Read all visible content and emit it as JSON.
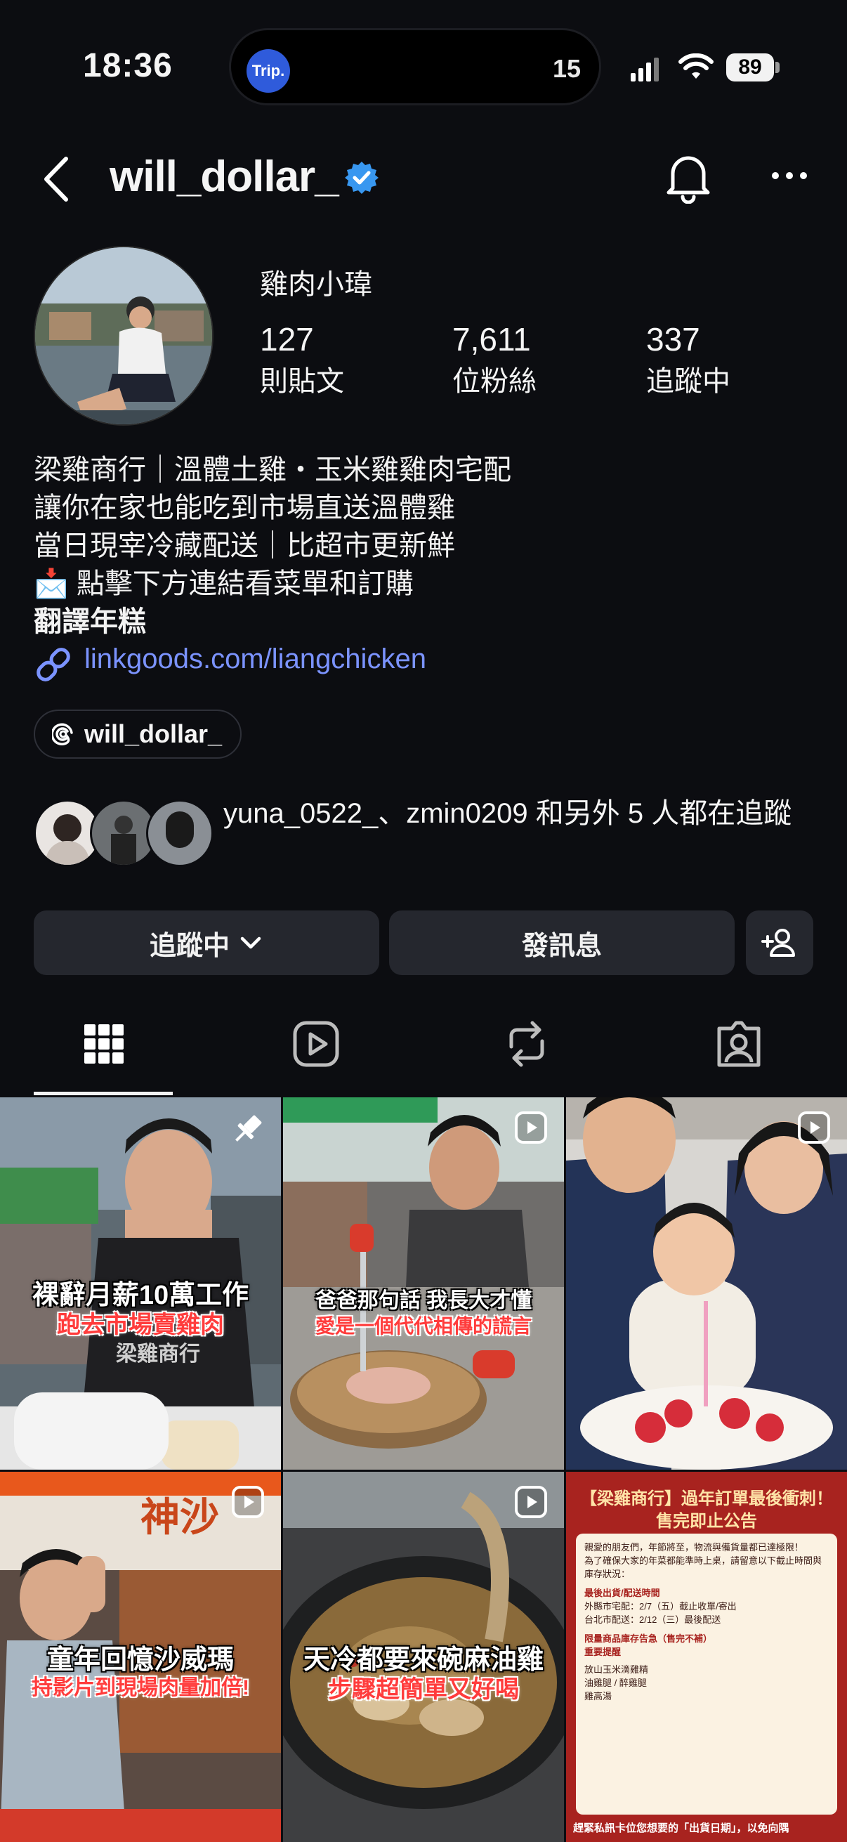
{
  "status_bar": {
    "time": "18:36",
    "island_app": "Trip.",
    "island_count": "15",
    "battery": "89"
  },
  "header": {
    "username": "will_dollar_",
    "verified": true,
    "icons": [
      "back-arrow-icon",
      "verified-badge-icon",
      "bell-icon",
      "more-icon"
    ]
  },
  "profile": {
    "display_name": "雞肉小瑋",
    "stats": [
      {
        "value": "127",
        "label": "則貼文"
      },
      {
        "value": "7,611",
        "label": "位粉絲"
      },
      {
        "value": "337",
        "label": "追蹤中"
      }
    ],
    "bio": [
      "梁雞商行｜溫體土雞・玉米雞雞肉宅配",
      "讓你在家也能吃到市場直送溫體雞",
      "當日現宰冷藏配送｜比超市更新鮮",
      "📩 點擊下方連結看菜單和訂購"
    ],
    "translate": "翻譯年糕",
    "link": "linkgoods.com/liangchicken",
    "threads_handle": "will_dollar_",
    "followed_by": "yuna_0522_、zmin0209 和另外 5 人都在追蹤"
  },
  "actions": {
    "following": "追蹤中",
    "message": "發訊息"
  },
  "tabs": [
    "grid-icon",
    "reels-icon",
    "reposts-icon",
    "tagged-icon"
  ],
  "posts": [
    {
      "caption1": "裸辭月薪10萬工作",
      "caption2": "跑去市場賣雞肉",
      "pinned": true,
      "apron_text": "梁雞商行"
    },
    {
      "caption1": "爸爸那句話 我長大才懂",
      "caption2": "愛是一個代代相傳的謊言",
      "reel": true
    },
    {
      "caption1": "",
      "caption2": "",
      "reel": true
    },
    {
      "caption1": "童年回憶沙威瑪",
      "caption2": "持影片到現場肉量加倍!",
      "reel": true,
      "sign_text": "神沙"
    },
    {
      "caption1": "天冷都要來碗麻油雞",
      "caption2": "步驟超簡單又好喝",
      "reel": true
    },
    {
      "poster_title": "【梁雞商行】過年訂單最後衝刺！",
      "poster_subtitle": "售完即止公告",
      "poster_lines": [
        "親愛的朋友們，年節將至，物流與備貨量都已達極限！",
        "為了確保大家的年菜都能準時上桌，請留意以下截止時間與庫存狀況：",
        "最後出貨/配送時間",
        "外縣市宅配：2/7（五）截止收單/寄出",
        "台北市配送：2/12（三）最後配送",
        "限量商品庫存告急（售完不補）",
        "重要提醒",
        "放山玉米滴雞精",
        "油雞腿 / 醉雞腿",
        "雞高湯",
        "趕緊私訊卡位您想要的「出貨日期」，以免向隅"
      ]
    }
  ],
  "colors": {
    "background": "#0c0d11",
    "link": "#7b93ff",
    "button": "#25272e",
    "verified": "#3897f0"
  }
}
